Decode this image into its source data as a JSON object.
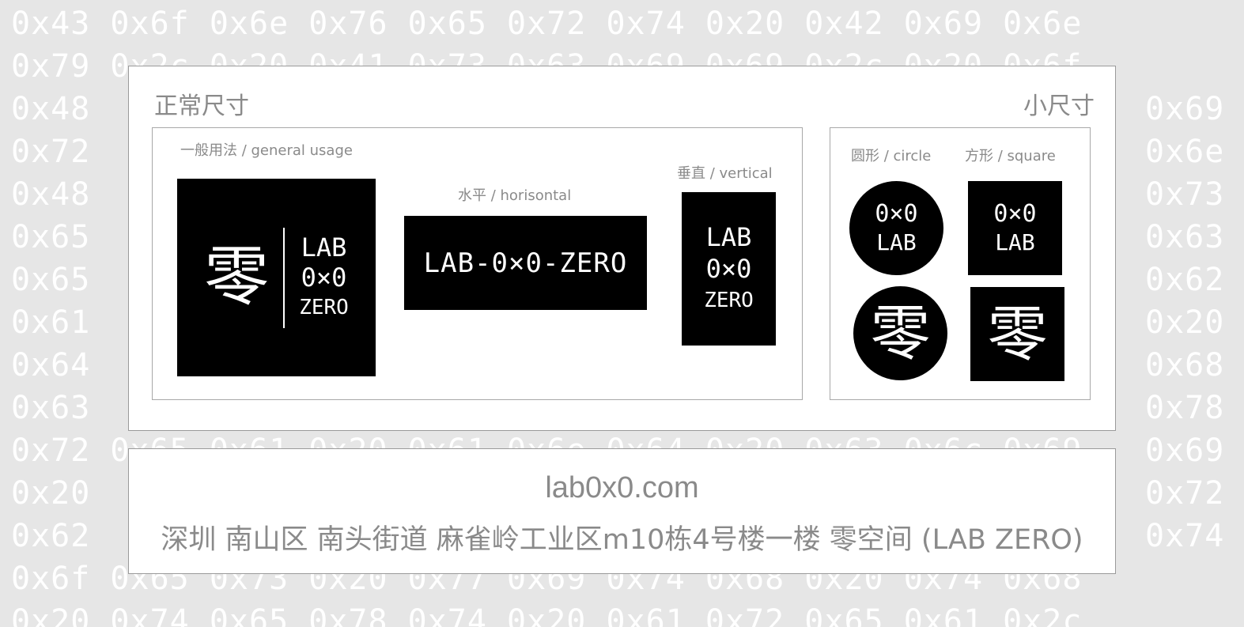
{
  "background_rows": [
    "0x43 0x6f 0x6e 0x76 0x65 0x72 0x74 0x20 0x42 0x69 0x6e",
    "0x79 0x2c 0x20 0x41 0x73 0x63 0x69 0x69 0x2c 0x20 0x6f",
    "0x48",
    "0x72",
    "0x48",
    "0x65",
    "0x65",
    "0x61",
    "0x64",
    "0x63",
    "0x72 0x65 0x61 0x20 0x61 0x6e 0x64 0x20 0x63 0x6c 0x69",
    "0x20",
    "0x62",
    "0x6f 0x65 0x73 0x20 0x77 0x69 0x74 0x68 0x20 0x74 0x68",
    "0x20 0x74 0x65 0x78 0x74 0x20 0x61 0x72 0x65 0x61 0x2c"
  ],
  "background_right_column": [
    "0x69",
    "0x6e",
    "0x73",
    "0x63",
    "0x62",
    "0x20",
    "0x68",
    "0x78",
    "0x69",
    "0x72",
    "0x74"
  ],
  "normal_size": {
    "title": "正常尺寸",
    "general": {
      "caption": "一般用法 / general usage",
      "glyph": "零",
      "line1": "LAB",
      "line2": "0×0",
      "line3": "ZERO"
    },
    "horizontal": {
      "caption": "水平 / horisontal",
      "text": "LAB-0×0-ZERO"
    },
    "vertical": {
      "caption": "垂直 / vertical",
      "line1": "LAB",
      "line2": "0×0",
      "line3": "ZERO"
    }
  },
  "small_size": {
    "title": "小尺寸",
    "circle": {
      "caption": "圆形 / circle",
      "line1": "0×0",
      "line2": "LAB",
      "glyph": "零"
    },
    "square": {
      "caption": "方形 / square",
      "line1": "0×0",
      "line2": "LAB",
      "glyph": "零"
    }
  },
  "footer": {
    "url": "lab0x0.com",
    "address": "深圳 南山区 南头街道 麻雀岭工业区m10栋4号楼一楼 零空间 (LAB ZERO)"
  }
}
